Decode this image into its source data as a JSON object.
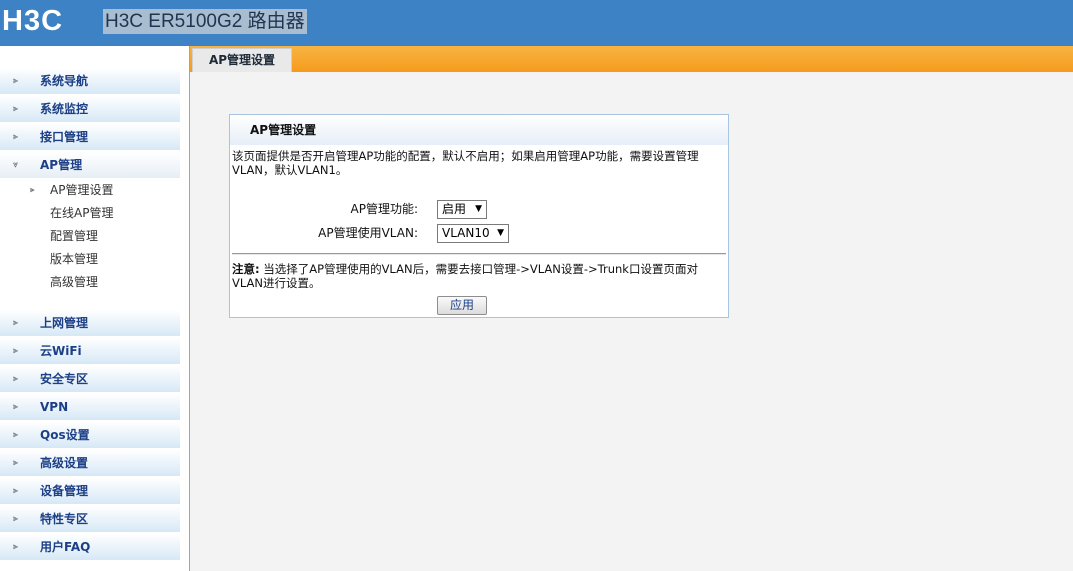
{
  "header": {
    "logo_text": "H3C",
    "title": "H3C ER5100G2 路由器"
  },
  "sidebar": {
    "items_top": [
      {
        "label": "系统导航"
      },
      {
        "label": "系统监控"
      },
      {
        "label": "接口管理"
      },
      {
        "label": "AP管理"
      }
    ],
    "sub_items": [
      {
        "label": "AP管理设置"
      },
      {
        "label": "在线AP管理"
      },
      {
        "label": "配置管理"
      },
      {
        "label": "版本管理"
      },
      {
        "label": "高级管理"
      }
    ],
    "items_bottom": [
      {
        "label": "上网管理"
      },
      {
        "label": "云WiFi"
      },
      {
        "label": "安全专区"
      },
      {
        "label": "VPN"
      },
      {
        "label": "Qos设置"
      },
      {
        "label": "高级设置"
      },
      {
        "label": "设备管理"
      },
      {
        "label": "特性专区"
      },
      {
        "label": "用户FAQ"
      }
    ]
  },
  "tab": {
    "label": "AP管理设置"
  },
  "panel": {
    "title": "AP管理设置",
    "description": "该页面提供是否开启管理AP功能的配置，默认不启用；如果启用管理AP功能，需要设置管理VLAN，默认VLAN1。",
    "fields": {
      "ap_function_label": "AP管理功能:",
      "ap_function_value": "启用",
      "ap_vlan_label": "AP管理使用VLAN:",
      "ap_vlan_value": "VLAN10"
    },
    "note_label": "注意:",
    "note_text": "当选择了AP管理使用的VLAN后，需要去接口管理->VLAN设置->Trunk口设置页面对VLAN进行设置。",
    "apply_label": "应用"
  },
  "colors": {
    "header_bg": "#3d82c4",
    "tabstrip_orange": "#f59b1c",
    "nav_text": "#1c3f86"
  },
  "icons": {
    "bullet": "nav-bullet-icon",
    "dropdown": "chevron-down-icon"
  }
}
